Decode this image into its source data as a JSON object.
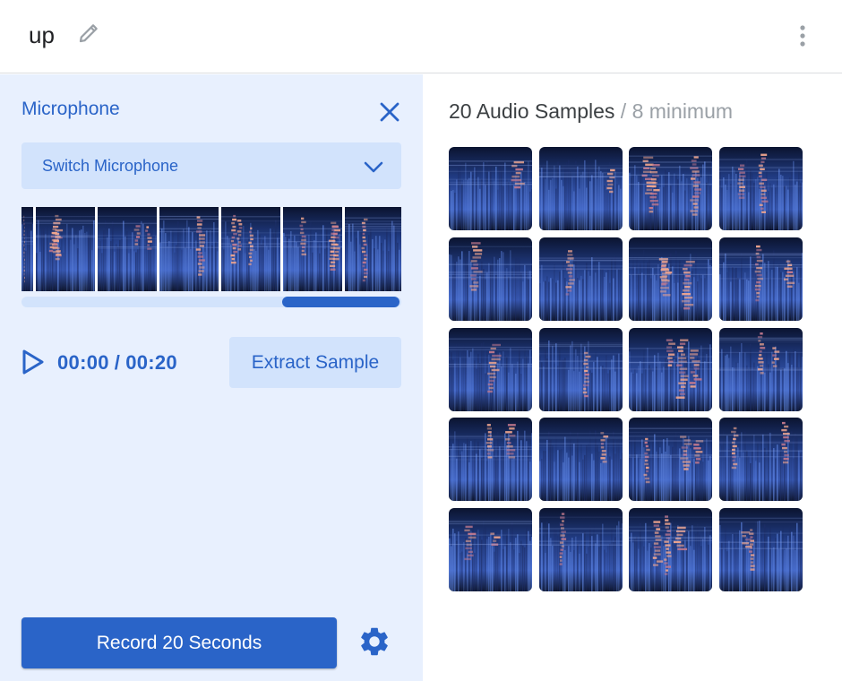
{
  "header": {
    "title": "up",
    "edit_icon": "pencil-icon",
    "more_icon": "more-vert-icon"
  },
  "microphone_panel": {
    "title": "Microphone",
    "close_icon": "close-icon",
    "switch_label": "Switch Microphone",
    "dropdown_icon": "chevron-down-icon",
    "playback": {
      "current_time": "00:00",
      "separator": "/",
      "total_time": "00:20",
      "play_icon": "play-icon"
    },
    "extract_label": "Extract Sample",
    "record_label": "Record 20 Seconds",
    "settings_icon": "gear-icon"
  },
  "samples_panel": {
    "count_label": "20 Audio Samples",
    "minimum_label": "/ 8 minimum",
    "sample_count": 20
  },
  "colors": {
    "accent": "#2a64c8",
    "panel_bg": "#e8f0fe",
    "button_light": "#d2e3fc",
    "spectrogram_dark": "#0b1430",
    "spectrogram_blue": "#3f63c4",
    "spectrogram_peak": "#f3a78e"
  }
}
